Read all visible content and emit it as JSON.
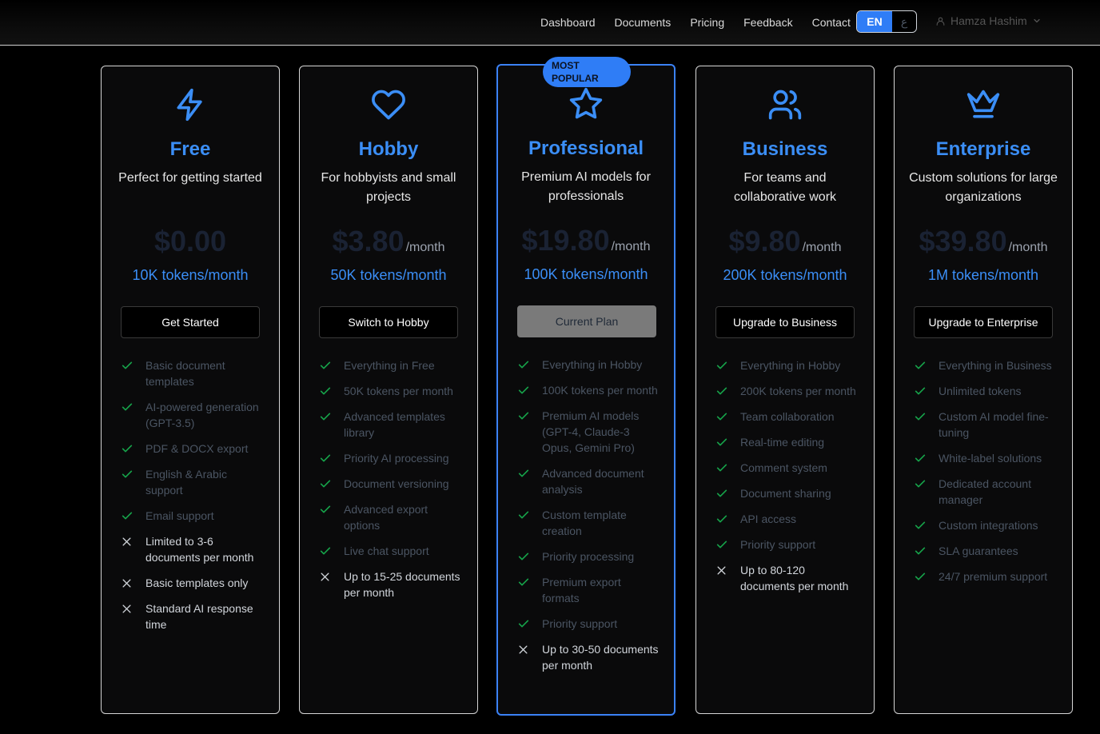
{
  "nav": {
    "links": [
      "Dashboard",
      "Documents",
      "Pricing",
      "Feedback",
      "Contact"
    ],
    "lang": {
      "en": "EN",
      "ar": "ع"
    },
    "user_name": "Hamza Hashim"
  },
  "colors": {
    "accent": "#3b8ef6",
    "check": "#16a34a",
    "badge": "#2f7df6"
  },
  "plans": [
    {
      "icon": "zap-icon",
      "name": "Free",
      "description": "Perfect for getting started",
      "price": "$0.00",
      "period": "",
      "tokens": "10K tokens/month",
      "button": "Get Started",
      "features": [
        {
          "text": "Basic document templates",
          "included": true
        },
        {
          "text": "AI-powered generation (GPT-3.5)",
          "included": true
        },
        {
          "text": "PDF & DOCX export",
          "included": true
        },
        {
          "text": "English & Arabic support",
          "included": true
        },
        {
          "text": "Email support",
          "included": true
        },
        {
          "text": "Limited to 3-6 documents per month",
          "included": false
        },
        {
          "text": "Basic templates only",
          "included": false
        },
        {
          "text": "Standard AI response time",
          "included": false
        }
      ]
    },
    {
      "icon": "heart-icon",
      "name": "Hobby",
      "description": "For hobbyists and small projects",
      "price": "$3.80",
      "period": "/month",
      "tokens": "50K tokens/month",
      "button": "Switch to Hobby",
      "features": [
        {
          "text": "Everything in Free",
          "included": true
        },
        {
          "text": "50K tokens per month",
          "included": true
        },
        {
          "text": "Advanced templates library",
          "included": true
        },
        {
          "text": "Priority AI processing",
          "included": true
        },
        {
          "text": "Document versioning",
          "included": true
        },
        {
          "text": "Advanced export options",
          "included": true
        },
        {
          "text": "Live chat support",
          "included": true
        },
        {
          "text": "Up to 15-25 documents per month",
          "included": false
        }
      ]
    },
    {
      "icon": "star-icon",
      "badge": "MOST POPULAR",
      "name": "Professional",
      "description": "Premium AI models for professionals",
      "price": "$19.80",
      "period": "/month",
      "tokens": "100K tokens/month",
      "button": "Current Plan",
      "current": true,
      "features": [
        {
          "text": "Everything in Hobby",
          "included": true
        },
        {
          "text": "100K tokens per month",
          "included": true
        },
        {
          "text": "Premium AI models (GPT-4, Claude-3 Opus, Gemini Pro)",
          "included": true
        },
        {
          "text": "Advanced document analysis",
          "included": true
        },
        {
          "text": "Custom template creation",
          "included": true
        },
        {
          "text": "Priority processing",
          "included": true
        },
        {
          "text": "Premium export formats",
          "included": true
        },
        {
          "text": "Priority support",
          "included": true
        },
        {
          "text": "Up to 30-50 documents per month",
          "included": false
        }
      ]
    },
    {
      "icon": "users-icon",
      "name": "Business",
      "description": "For teams and collaborative work",
      "price": "$9.80",
      "period": "/month",
      "tokens": "200K tokens/month",
      "button": "Upgrade to Business",
      "features": [
        {
          "text": "Everything in Hobby",
          "included": true
        },
        {
          "text": "200K tokens per month",
          "included": true
        },
        {
          "text": "Team collaboration",
          "included": true
        },
        {
          "text": "Real-time editing",
          "included": true
        },
        {
          "text": "Comment system",
          "included": true
        },
        {
          "text": "Document sharing",
          "included": true
        },
        {
          "text": "API access",
          "included": true
        },
        {
          "text": "Priority support",
          "included": true
        },
        {
          "text": "Up to 80-120 documents per month",
          "included": false
        }
      ]
    },
    {
      "icon": "crown-icon",
      "name": "Enterprise",
      "description": "Custom solutions for large organizations",
      "price": "$39.80",
      "period": "/month",
      "tokens": "1M tokens/month",
      "button": "Upgrade to Enterprise",
      "features": [
        {
          "text": "Everything in Business",
          "included": true
        },
        {
          "text": "Unlimited tokens",
          "included": true
        },
        {
          "text": "Custom AI model fine-tuning",
          "included": true
        },
        {
          "text": "White-label solutions",
          "included": true
        },
        {
          "text": "Dedicated account manager",
          "included": true
        },
        {
          "text": "Custom integrations",
          "included": true
        },
        {
          "text": "SLA guarantees",
          "included": true
        },
        {
          "text": "24/7 premium support",
          "included": true
        }
      ]
    }
  ]
}
